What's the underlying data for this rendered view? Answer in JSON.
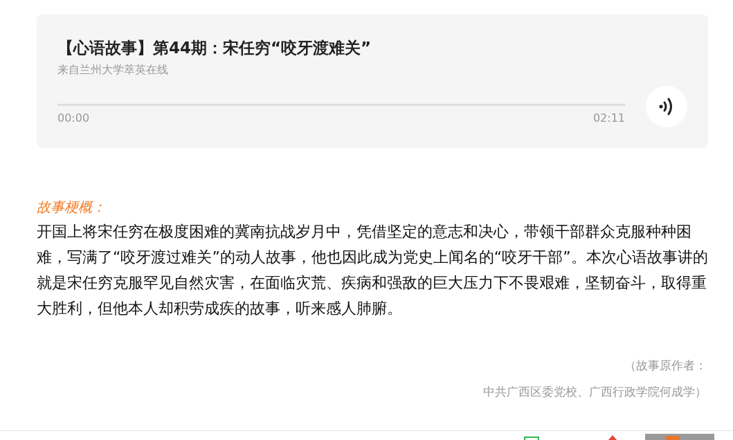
{
  "audio_player": {
    "title": "【心语故事】第44期：宋任穷“咬牙渡难关”",
    "source": "来自兰州大学萃英在线",
    "current_time": "00:00",
    "duration": "02:11"
  },
  "summary": {
    "label": "故事梗概：",
    "text": "开国上将宋任穷在极度困难的冀南抗战岁月中，凭借坚定的意志和决心，带领干部群众克服种种困难，写满了“咬牙渡过难关”的动人故事，他也因此成为党史上闻名的“咬牙干部”。本次心语故事讲的就是宋任穷克服罕见自然灾害，在面临灾荒、疾病和强敌的巨大压力下不畏艰难，坚韧奋斗，取得重大胜利，但他本人却积劳成疾的故事，听来感人肺腑。"
  },
  "credits": [
    "（故事原作者：",
    "中共广西区委党校、广西行政学院何成学）"
  ]
}
